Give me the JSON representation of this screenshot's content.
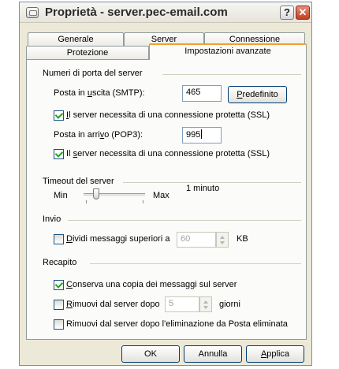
{
  "window": {
    "title": "Proprietà - server.pec-email.com",
    "help_label": "?",
    "close_label": "✕"
  },
  "tabs": {
    "row1": [
      "Generale",
      "Server",
      "Connessione"
    ],
    "row2": [
      "Protezione",
      "Impostazioni avanzate"
    ],
    "active": "Impostazioni avanzate"
  },
  "ports": {
    "section_label": "Numeri di porta del server",
    "smtp_label_pre": "Posta in ",
    "smtp_label_u": "u",
    "smtp_label_post": "scita (SMTP):",
    "smtp_value": "465",
    "default_button_u": "P",
    "default_button_post": "redefinito",
    "smtp_ssl_u": "I",
    "smtp_ssl_post": "l server necessita di una connessione protetta (SSL)",
    "smtp_ssl_checked": true,
    "pop3_label_pre": "Posta in arri",
    "pop3_label_u": "v",
    "pop3_label_post": "o (POP3):",
    "pop3_value": "995",
    "pop3_ssl_pre": "Il ",
    "pop3_ssl_u": "s",
    "pop3_ssl_post": "erver necessita di una connessione protetta (SSL)",
    "pop3_ssl_checked": true
  },
  "timeout": {
    "section_label": "Timeout del server",
    "min_label": "Min",
    "max_label": "Max",
    "value_label": "1 minuto",
    "level": 0.17
  },
  "send": {
    "section_label": "Invio",
    "split_label_u": "D",
    "split_label_post": "ividi messaggi superiori a",
    "split_checked": false,
    "split_value": "60",
    "split_unit": "KB"
  },
  "delivery": {
    "section_label": "Recapito",
    "keep_copy_u": "C",
    "keep_copy_post": "onserva una copia dei messaggi sul server",
    "keep_copy_checked": true,
    "remove_after_u": "R",
    "remove_after_post": "imuovi dal server dopo",
    "remove_after_checked": false,
    "remove_days_value": "5",
    "days_unit": "giorni",
    "remove_deleted_label": "Rimuovi dal server dopo l'eliminazione da Posta eliminata",
    "remove_deleted_checked": false
  },
  "buttons": {
    "ok": "OK",
    "cancel": "Annulla",
    "apply_u": "A",
    "apply_post": "pplica"
  },
  "colors": {
    "dialog_bg": "#ece9d8",
    "active_tab_accent": "#f0a030",
    "check_green": "#21a121"
  }
}
